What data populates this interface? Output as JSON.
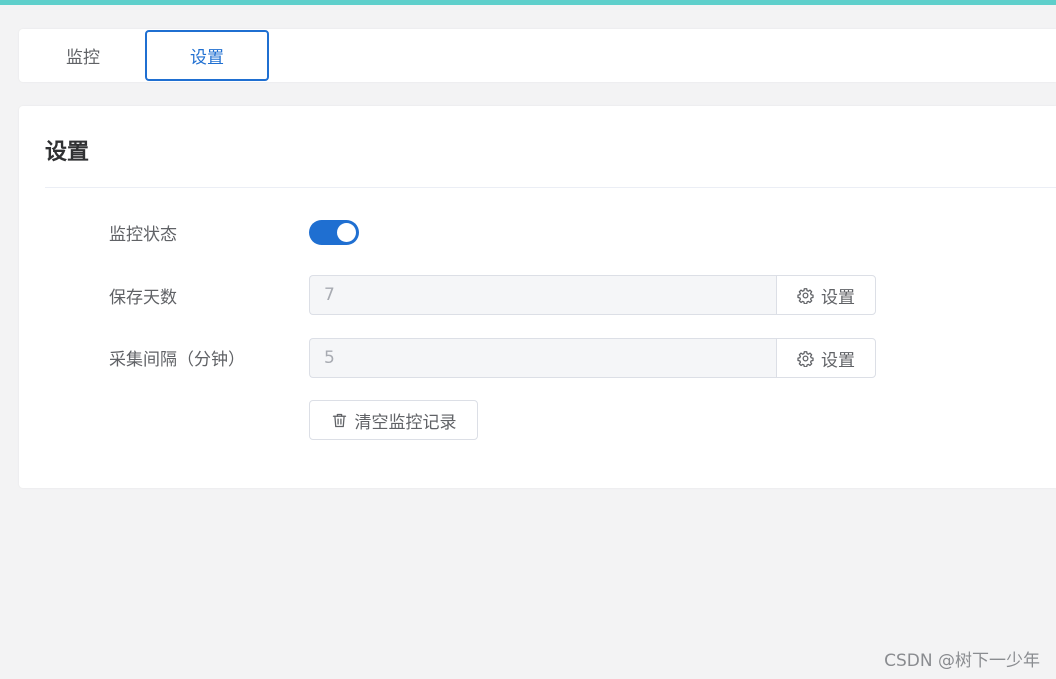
{
  "tabs": [
    {
      "label": "监控",
      "active": false
    },
    {
      "label": "设置",
      "active": true
    }
  ],
  "settings": {
    "title": "设置",
    "monitor_status": {
      "label": "监控状态",
      "enabled": true
    },
    "save_days": {
      "label": "保存天数",
      "value": "7",
      "button_label": "设置"
    },
    "collect_interval": {
      "label": "采集间隔（分钟）",
      "value": "5",
      "button_label": "设置"
    },
    "clear_button_label": "清空监控记录"
  },
  "watermark": "CSDN @树下一少年",
  "colors": {
    "accent": "#1f6fd1",
    "top_bar": "#5ecfcb",
    "background": "#f3f3f4"
  },
  "icons": {
    "settings_button": "gear-icon",
    "clear_button": "trash-icon"
  }
}
